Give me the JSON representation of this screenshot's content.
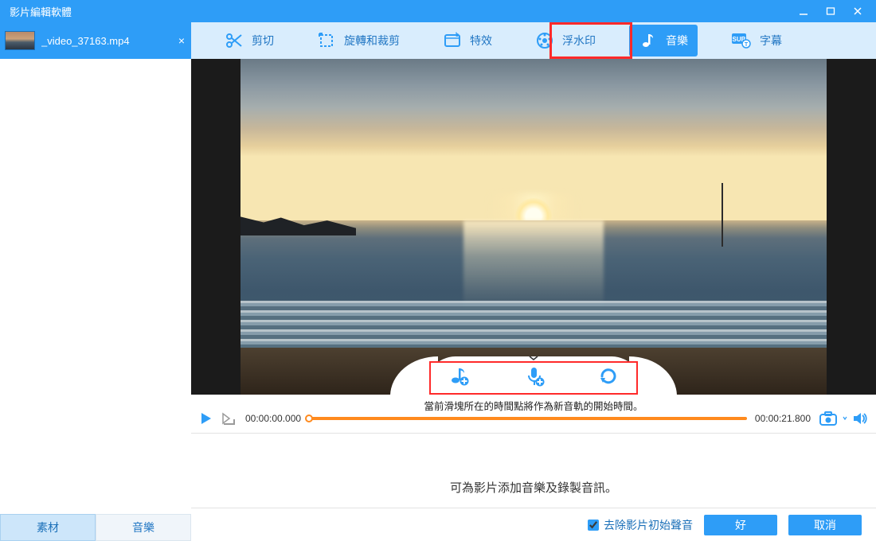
{
  "window": {
    "title": "影片編輯軟體"
  },
  "file": {
    "name": "_video_37163.mp4"
  },
  "toolbar": {
    "cut": "剪切",
    "rotate": "旋轉和裁剪",
    "effect": "特效",
    "watermark": "浮水印",
    "music": "音樂",
    "subtitle": "字幕"
  },
  "sidebar": {
    "tab_material": "素材",
    "tab_music": "音樂"
  },
  "timeline": {
    "start": "00:00:00.000",
    "end": "00:00:21.800",
    "hint": "當前滑塊所在的時間點將作為新音軌的開始時間。"
  },
  "help": {
    "text": "可為影片添加音樂及錄製音訊。"
  },
  "footer": {
    "remove_audio": "去除影片初始聲音",
    "ok": "好",
    "cancel": "取消"
  }
}
